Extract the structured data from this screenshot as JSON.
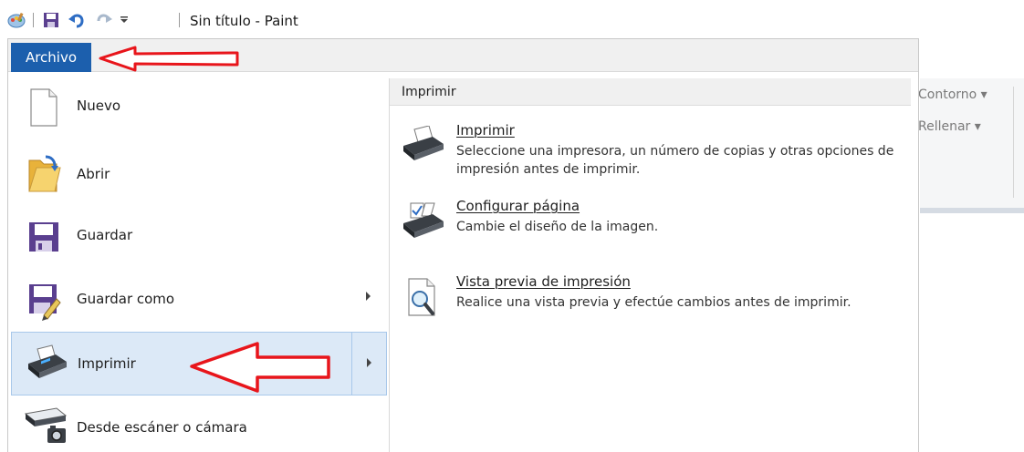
{
  "title_bar": {
    "title": "Sin título - Paint",
    "quick_access": [
      "paint-app-icon",
      "save-icon",
      "undo-icon",
      "redo-icon",
      "customize-dropdown-icon"
    ]
  },
  "file_tab": {
    "label": "Archivo",
    "color": "#1c5fad"
  },
  "ribbon_partial": {
    "outline_label": "Contorno ▾",
    "fill_label": "Rellenar ▾"
  },
  "file_menu": {
    "items": [
      {
        "label": "Nuevo",
        "icon": "new-document-icon",
        "has_submenu": false
      },
      {
        "label": "Abrir",
        "icon": "open-folder-icon",
        "has_submenu": false
      },
      {
        "label": "Guardar",
        "icon": "save-icon",
        "has_submenu": false
      },
      {
        "label": "Guardar como",
        "icon": "save-as-icon",
        "has_submenu": true
      },
      {
        "label": "Imprimir",
        "icon": "printer-icon",
        "has_submenu": true,
        "selected": true
      },
      {
        "label": "Desde escáner o cámara",
        "icon": "scanner-icon",
        "has_submenu": false
      }
    ]
  },
  "print_submenu": {
    "header": "Imprimir",
    "items": [
      {
        "title": "Imprimir",
        "description": "Seleccione una impresora, un número de copias y otras opciones de impresión antes de imprimir.",
        "icon": "printer-icon"
      },
      {
        "title": "Configurar página",
        "description": "Cambie el diseño de la imagen.",
        "icon": "page-setup-icon"
      },
      {
        "title": "Vista previa de impresión",
        "description": "Realice una vista previa y efectúe cambios antes de imprimir.",
        "icon": "print-preview-icon"
      }
    ]
  },
  "annotation_color": "#e8151b"
}
